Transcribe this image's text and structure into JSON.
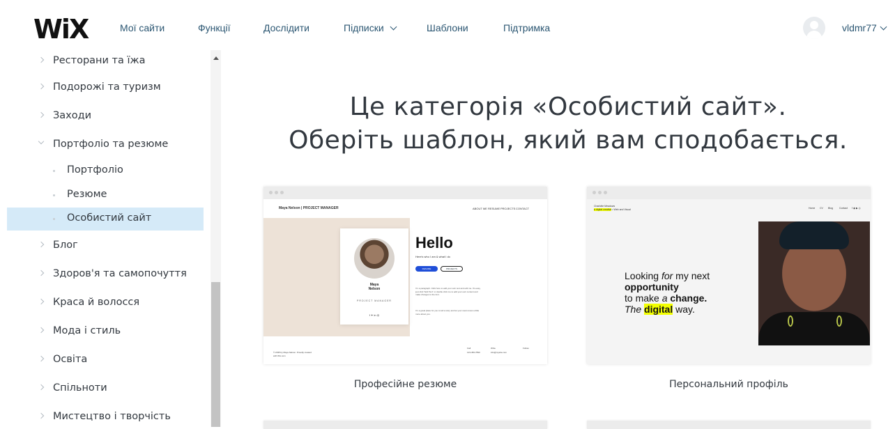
{
  "nav": {
    "logo": "WiX",
    "items": [
      "Мої сайти",
      "Функції",
      "Дослідити",
      "Підписки",
      "Шаблони",
      "Підтримка"
    ],
    "username": "vldmr77"
  },
  "sidebar": {
    "items": [
      {
        "label": "Ресторани та їжа"
      },
      {
        "label": "Подорожі та туризм"
      },
      {
        "label": "Заходи"
      },
      {
        "label": "Портфоліо та резюме"
      },
      {
        "label": "Портфоліо"
      },
      {
        "label": "Резюме"
      },
      {
        "label": "Особистий сайт"
      },
      {
        "label": "Блог"
      },
      {
        "label": "Здоров'я та самопочуття"
      },
      {
        "label": "Краса й волосся"
      },
      {
        "label": "Мода і стиль"
      },
      {
        "label": "Освіта"
      },
      {
        "label": "Спільноти"
      },
      {
        "label": "Мистецтво і творчість"
      }
    ]
  },
  "main": {
    "heading_line1": "Це категорія «Особистий сайт».",
    "heading_line2": "Оберіть шаблон, який вам сподобається.",
    "templates": [
      {
        "title": "Професійне резюме",
        "preview": {
          "logo": "Maya Nelson  |  PROJECT MANAGER",
          "nav": [
            "ABOUT ME",
            "RESUME",
            "PROJECTS",
            "CONTACT"
          ],
          "name_line1": "Maya",
          "name_line2": "Nelson",
          "role": "PROJECT MANAGER",
          "social": "f  ✦  in  ◎",
          "hello": "Hello",
          "subtitle": "Here's who I am & what I do",
          "btn1": "RESUME",
          "btn2": "PROJECTS",
          "para1": "I'm a paragraph. Click here to add your own text and edit me. It's easy, just click \"Edit Text\" or double click me to add your own content and make changes to the font.",
          "para2": "I'm a great place for you to tell a story and let your users know a little more about you.",
          "foot_left": "© 2035 by Maya Nelson. Proudly created with Wix.com",
          "foot_call": "Call",
          "foot_phone": "123-456-7890",
          "foot_write": "Write",
          "foot_email": "info@mysite.com",
          "foot_follow": "Follow"
        }
      },
      {
        "title": "Персональний профіль",
        "preview": {
          "top_name": "Charlotte Meadows",
          "top_tag": "a digital creative",
          "top_rest": " • Web and Visual",
          "nav": [
            "Home",
            "CV",
            "Blog",
            "Contact"
          ],
          "line1_a": "Looking ",
          "line1_b": "for",
          "line1_c": " my next",
          "line2": "opportunity",
          "line3_a": "to make ",
          "line3_b": "a",
          "line3_c": " change.",
          "line4_a": "The ",
          "line4_b": "digital",
          "line4_c": " way."
        }
      }
    ]
  }
}
